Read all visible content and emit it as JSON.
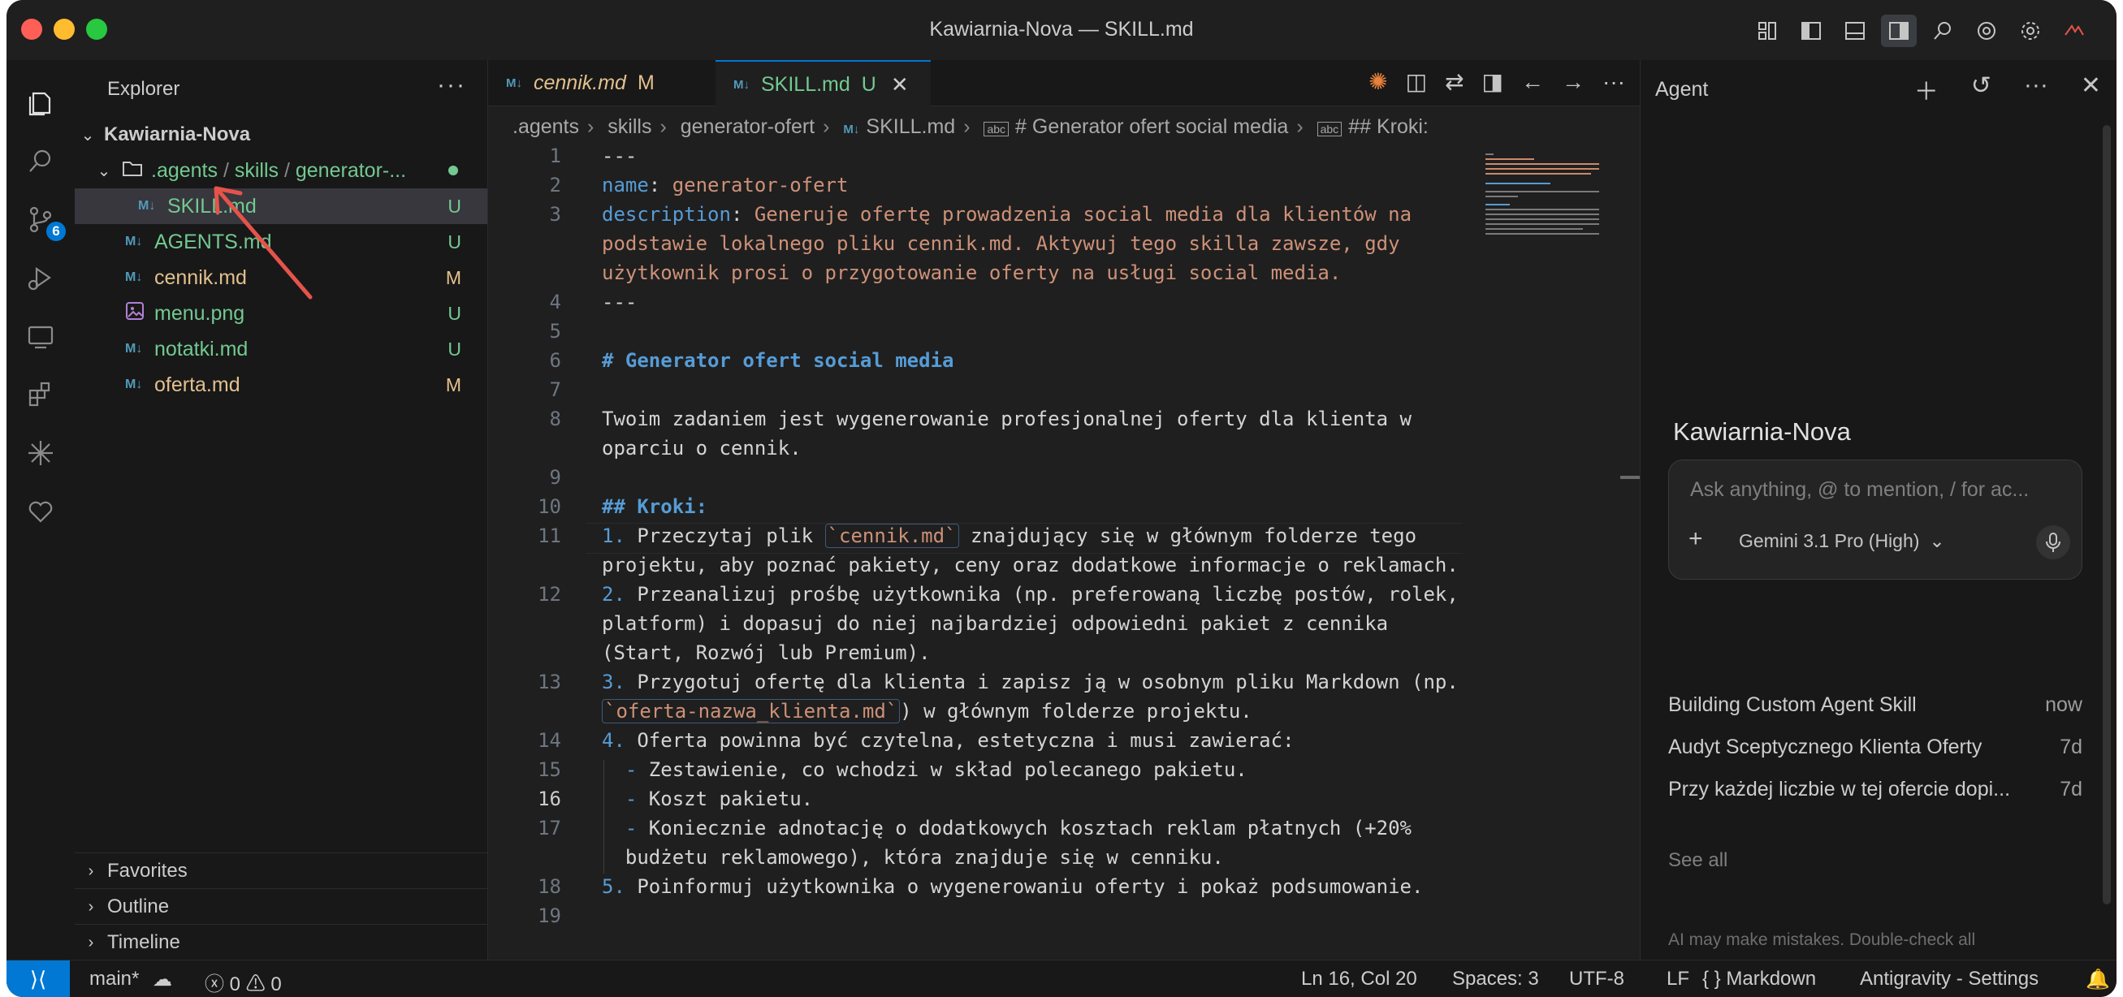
{
  "window": {
    "title": "Kawiarnia-Nova — SKILL.md"
  },
  "explorer": {
    "title": "Explorer",
    "more": "···",
    "root": "Kawiarnia-Nova",
    "folder": ".agents/skills/generator-...",
    "folder_parts": [
      ".agents",
      "skills",
      "generator-..."
    ],
    "files": [
      {
        "name": "SKILL.md",
        "status": "U",
        "icon": "markdown-icon"
      },
      {
        "name": "AGENTS.md",
        "status": "U",
        "icon": "markdown-icon"
      },
      {
        "name": "cennik.md",
        "status": "M",
        "icon": "markdown-icon"
      },
      {
        "name": "menu.png",
        "status": "U",
        "icon": "image-icon"
      },
      {
        "name": "notatki.md",
        "status": "U",
        "icon": "markdown-icon"
      },
      {
        "name": "oferta.md",
        "status": "M",
        "icon": "markdown-icon"
      }
    ],
    "sections": [
      "Favorites",
      "Outline",
      "Timeline"
    ]
  },
  "activity": {
    "scm_badge": "6"
  },
  "tabs": [
    {
      "label": "cennik.md",
      "status": "M"
    },
    {
      "label": "SKILL.md",
      "status": "U"
    }
  ],
  "breadcrumbs": [
    ".agents",
    "skills",
    "generator-ofert",
    "SKILL.md",
    "# Generator ofert social media",
    "## Kroki:"
  ],
  "editor": {
    "lines": [
      {
        "n": "1",
        "text": "---"
      },
      {
        "n": "2",
        "key": "name",
        "value": "generator-ofert"
      },
      {
        "n": "3",
        "key": "description",
        "value": "Generuje ofertę prowadzenia social media dla klientów na",
        "cont": [
          "podstawie lokalnego pliku cennik.md. Aktywuj tego skilla zawsze, gdy",
          "użytkownik prosi o przygotowanie oferty na usługi social media."
        ]
      },
      {
        "n": "4",
        "text": "---"
      },
      {
        "n": "5",
        "text": ""
      },
      {
        "n": "6",
        "text": "# Generator ofert social media"
      },
      {
        "n": "7",
        "text": ""
      },
      {
        "n": "8",
        "text": "Twoim zadaniem jest wygenerowanie profesjonalnej oferty dla klienta w",
        "cont": [
          "oparciu o cennik."
        ]
      },
      {
        "n": "9",
        "text": ""
      },
      {
        "n": "10",
        "text": "## Kroki:"
      },
      {
        "n": "11",
        "num": "1.",
        "pre": " Przeczytaj plik ",
        "code": "`cennik.md`",
        "post": " znajdujący się w głównym folderze tego",
        "cont": [
          "projektu, aby poznać pakiety, ceny oraz dodatkowe informacje o reklamach."
        ]
      },
      {
        "n": "12",
        "num": "2.",
        "text": " Przeanalizuj prośbę użytkownika (np. preferowaną liczbę postów, rolek,",
        "cont": [
          "platform) i dopasuj do niej najbardziej odpowiedni pakiet z cennika",
          "(Start, Rozwój lub Premium)."
        ]
      },
      {
        "n": "13",
        "num": "3.",
        "text": " Przygotuj ofertę dla klienta i zapisz ją w osobnym pliku Markdown (np.",
        "code": "`oferta-nazwa_klienta.md`",
        "post": ") w głównym folderze projektu."
      },
      {
        "n": "14",
        "num": "4.",
        "text": " Oferta powinna być czytelna, estetyczna i musi zawierać:"
      },
      {
        "n": "15",
        "dash": "-",
        "text": " Zestawienie, co wchodzi w skład polecanego pakietu."
      },
      {
        "n": "16",
        "dash": "-",
        "text": " Koszt pakietu."
      },
      {
        "n": "17",
        "dash": "-",
        "text": " Koniecznie adnotację o dodatkowych kosztach reklam płatnych (+20%",
        "cont": [
          "budżetu reklamowego), która znajduje się w cenniku."
        ]
      },
      {
        "n": "18",
        "num": "5.",
        "text": " Poinformuj użytkownika o wygenerowaniu oferty i pokaż podsumowanie."
      },
      {
        "n": "19",
        "text": ""
      }
    ]
  },
  "agent": {
    "title": "Agent",
    "project": "Kawiarnia-Nova",
    "placeholder": "Ask anything, @ to mention, / for ac...",
    "model": "Gemini 3.1 Pro (High)",
    "conversations": [
      {
        "title": "Building Custom Agent Skill",
        "time": "now"
      },
      {
        "title": "Audyt Sceptycznego Klienta Oferty",
        "time": "7d"
      },
      {
        "title": "Przy każdej liczbie w tej ofercie dopi...",
        "time": "7d"
      }
    ],
    "see_all": "See all",
    "disclaimer": "AI may make mistakes. Double-check all"
  },
  "status": {
    "branch": "main*",
    "errors": "0",
    "warnings": "0",
    "position": "Ln 16, Col 20",
    "spaces": "Spaces: 3",
    "encoding": "UTF-8",
    "eol": "LF",
    "language": "Markdown",
    "settings": "Antigravity - Settings"
  },
  "colors": {
    "accent": "#0078d4",
    "untracked": "#73c991",
    "modified": "#e2c08d",
    "arrow": "#e5534b"
  }
}
